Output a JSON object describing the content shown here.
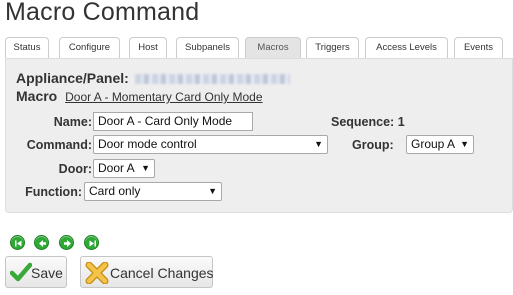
{
  "page": {
    "title": "Macro Command"
  },
  "tabs": [
    {
      "label": "Status",
      "active": false
    },
    {
      "label": "Configure",
      "active": false
    },
    {
      "label": "Host",
      "active": false
    },
    {
      "label": "Subpanels",
      "active": false
    },
    {
      "label": "Macros",
      "active": true
    },
    {
      "label": "Triggers",
      "active": false
    },
    {
      "label": "Access Levels",
      "active": false
    },
    {
      "label": "Events",
      "active": false
    }
  ],
  "panel": {
    "appliance_label": "Appliance/Panel:",
    "macro_label": "Macro",
    "macro_link_text": "Door A - Momentary Card Only Mode"
  },
  "form": {
    "name_label": "Name:",
    "name_value": "Door A - Card Only Mode",
    "sequence_label": "Sequence:",
    "sequence_value": "1",
    "command_label": "Command:",
    "command_value": "Door mode control",
    "group_label": "Group:",
    "group_value": "Group A",
    "door_label": "Door:",
    "door_value": "Door A",
    "function_label": "Function:",
    "function_value": "Card only"
  },
  "navigation": {
    "icons": [
      "first-record-icon",
      "previous-record-icon",
      "next-record-icon",
      "last-record-icon"
    ],
    "color": "#2fa836"
  },
  "actions": {
    "save_label": "Save",
    "cancel_label": "Cancel Changes"
  },
  "colors": {
    "panel_bg": "#eeeeee",
    "active_tab_bg": "#e4e4e4",
    "nav_green": "#2fa836",
    "save_check": "#3aa93a",
    "cancel_x": "#e8b12a"
  }
}
